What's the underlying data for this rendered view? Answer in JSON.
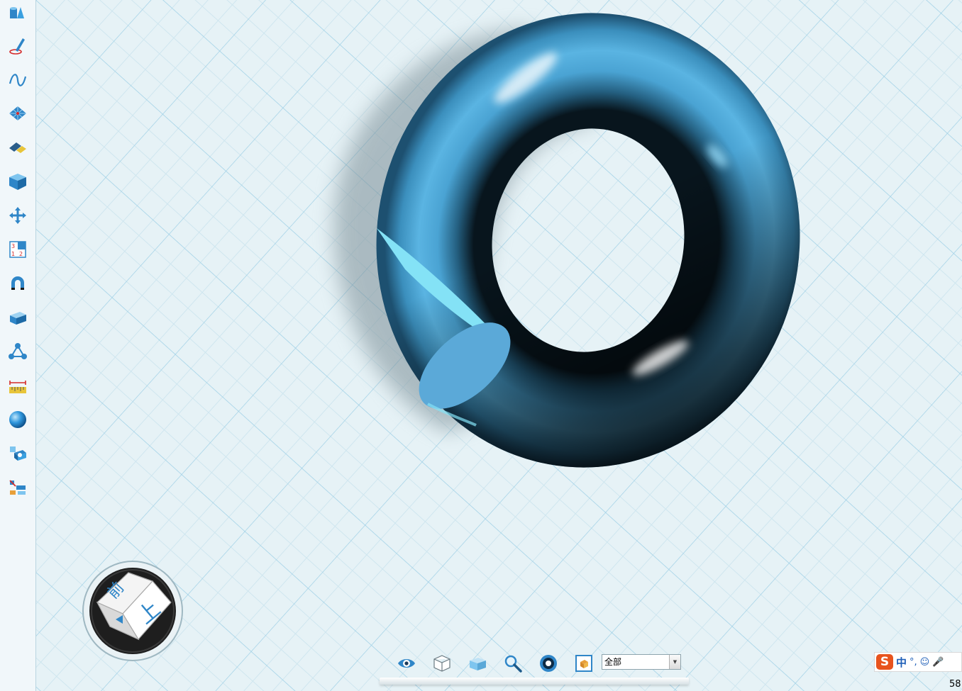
{
  "sidebar": {
    "tools": [
      {
        "name": "basic-shapes-tool",
        "icon": "shapes-icon"
      },
      {
        "name": "sketch-draw-tool",
        "icon": "pen-icon"
      },
      {
        "name": "curve-tool",
        "icon": "curve-icon"
      },
      {
        "name": "special-feature-tool",
        "icon": "grid-feature-icon"
      },
      {
        "name": "edit-tool",
        "icon": "eraser-icon"
      },
      {
        "name": "combine-tool",
        "icon": "cube-icon"
      },
      {
        "name": "move-tool",
        "icon": "move-arrows-icon"
      },
      {
        "name": "pattern-tool",
        "icon": "numbered-grid-icon"
      },
      {
        "name": "snap-tool",
        "icon": "magnet-icon"
      },
      {
        "name": "transform-box-tool",
        "icon": "box-icon"
      },
      {
        "name": "distribution-tool",
        "icon": "nodes-icon"
      },
      {
        "name": "measure-tool",
        "icon": "ruler-icon"
      },
      {
        "name": "material-tool",
        "icon": "sphere-icon"
      },
      {
        "name": "plugin-tool",
        "icon": "plugin-icon"
      },
      {
        "name": "assembly-tool",
        "icon": "assembly-icon"
      }
    ]
  },
  "viewcube": {
    "top_face_label": "上",
    "front_face_label": "前"
  },
  "bottom_toolbar": {
    "buttons": [
      {
        "name": "view-toggle-button",
        "icon": "eye-icon"
      },
      {
        "name": "wireframe-view-button",
        "icon": "wire-cube-icon"
      },
      {
        "name": "shaded-view-button",
        "icon": "solid-cube-icon"
      },
      {
        "name": "zoom-button",
        "icon": "magnifier-icon"
      },
      {
        "name": "render-button",
        "icon": "lens-icon"
      },
      {
        "name": "fit-view-button",
        "icon": "frame-icon"
      }
    ],
    "filter": {
      "value": "全部"
    }
  },
  "ime": {
    "logo": "S",
    "mode": "中",
    "punct": "°,",
    "emoji": "☺",
    "mic": "🎤"
  },
  "status": {
    "corner_text": "58"
  },
  "colors": {
    "viewport_bg": "#e6f2f6",
    "grid_line": "#9fd0e6",
    "torus_main": "#4aa3d3",
    "torus_dark": "#0a1a24",
    "cut_face": "#5ba9d8",
    "cut_face_light": "#84e2f6"
  }
}
